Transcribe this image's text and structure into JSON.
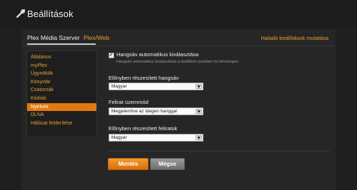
{
  "header": {
    "title": "Beállítások",
    "icon": "wrench-icon"
  },
  "tabs": {
    "active": "Plex Média Szerver",
    "web": "Plex/Web"
  },
  "advanced_link": "Haladó beállítások mutatása",
  "sidebar": {
    "items": [
      {
        "label": "Általános",
        "active": false
      },
      {
        "label": "myPlex",
        "active": false
      },
      {
        "label": "Ügynökök",
        "active": false
      },
      {
        "label": "Könyvtár",
        "active": false
      },
      {
        "label": "Csatornák",
        "active": false
      },
      {
        "label": "Kódoló",
        "active": false
      },
      {
        "label": "Nyelvek",
        "active": true
      },
      {
        "label": "DLNA",
        "active": false
      },
      {
        "label": "Hálózat felderítése",
        "active": false
      }
    ]
  },
  "form": {
    "auto_audio": {
      "label": "Hangsáv automatikus kiválasztása",
      "help": "Hangsáv automatikus kiválasztása a beállított nyelvben ha lehetséges",
      "checked": true
    },
    "preferred_audio": {
      "label": "Előnyben részesített hangsáv",
      "value": "Magyar"
    },
    "subtitle_mode": {
      "label": "Felirat üzemmód",
      "value": "Megjelenítve az idegen hanggal"
    },
    "preferred_subtitles": {
      "label": "Előnyben részesített feliratok",
      "value": "Magyar"
    }
  },
  "buttons": {
    "save": "Mentés",
    "cancel": "Mégse"
  },
  "colors": {
    "accent": "#e07a10",
    "link": "#e9a030",
    "background": "#1f1f1f"
  }
}
